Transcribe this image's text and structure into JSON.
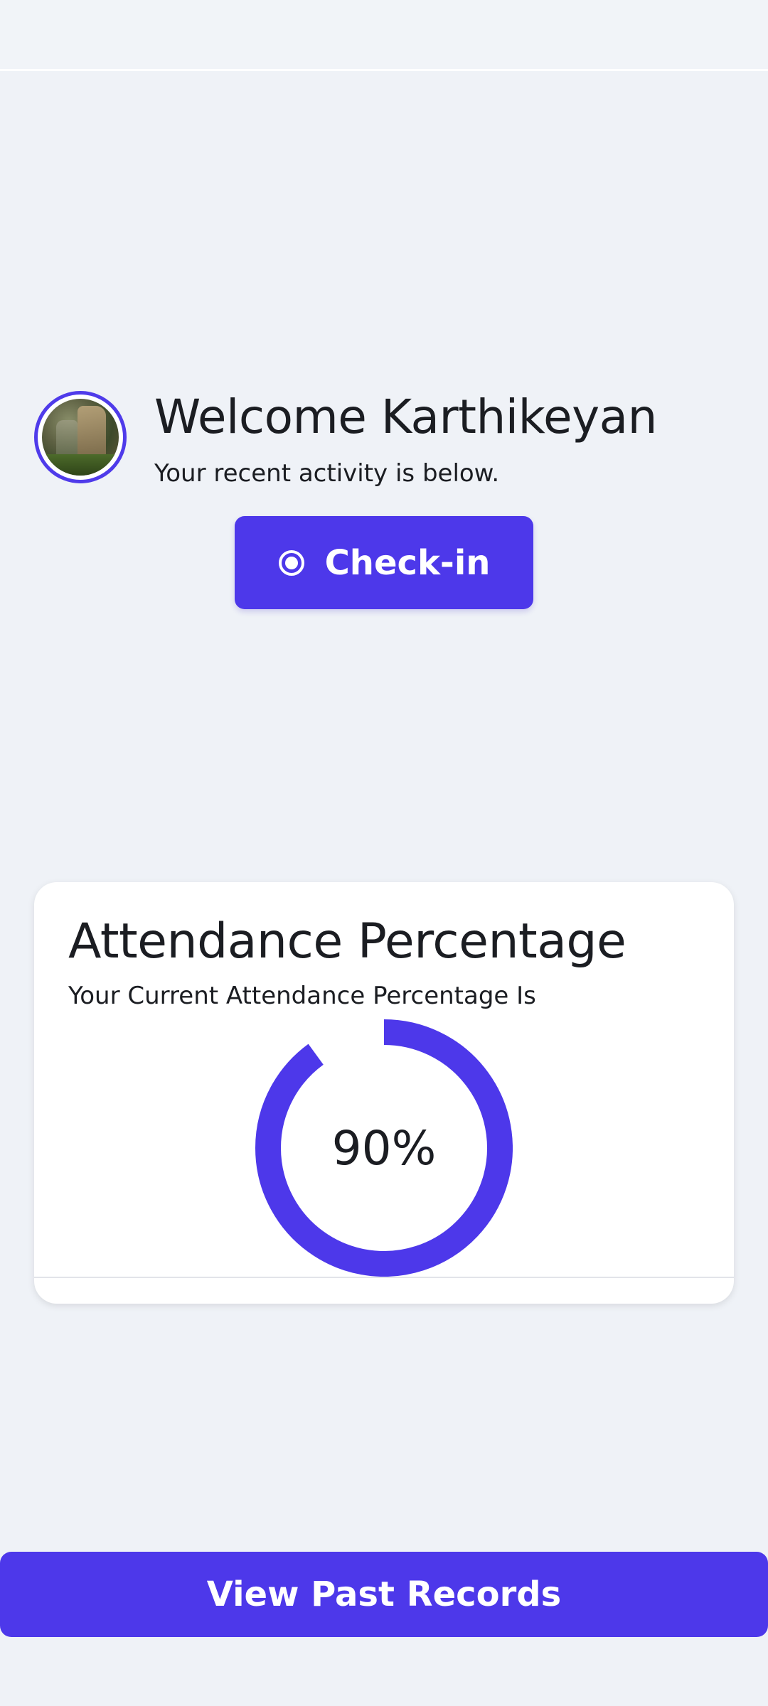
{
  "header": {},
  "profile": {
    "welcome": "Welcome Karthikeyan",
    "subtitle": "Your recent activity is below.",
    "avatar_icon": "user-avatar-photo"
  },
  "checkin": {
    "label": "Check-in",
    "icon": "radio-dot-icon"
  },
  "attendance": {
    "title": "Attendance Percentage",
    "subtitle": "Your Current Attendance Percentage Is",
    "value_text": "90%",
    "percent": 90
  },
  "footer": {
    "past_records_label": "View Past Records"
  },
  "colors": {
    "accent": "#4d38ea",
    "background": "#eff2f7",
    "card": "#ffffff",
    "text": "#1b1d22"
  }
}
